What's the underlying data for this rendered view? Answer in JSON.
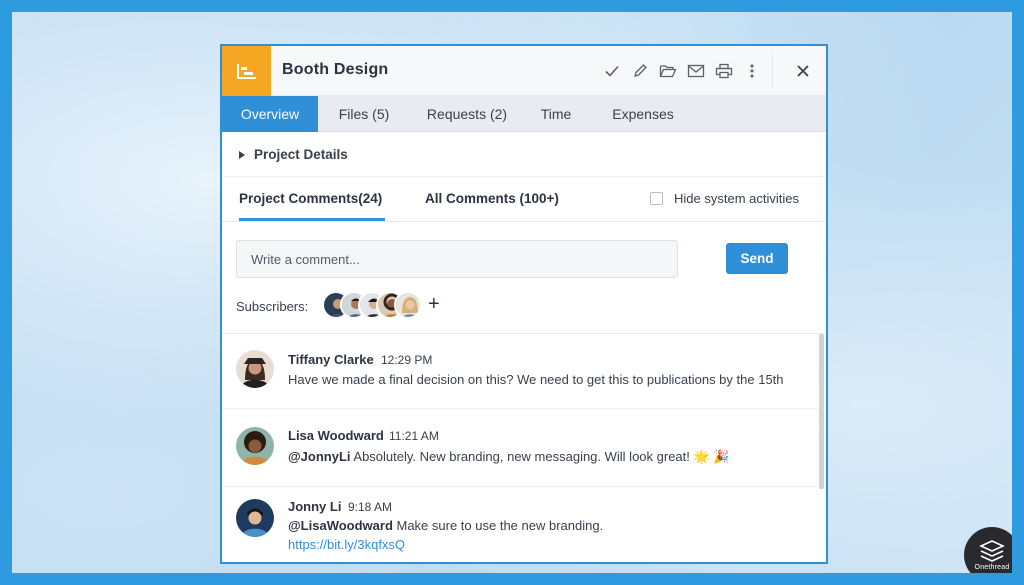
{
  "window": {
    "title": "Booth Design",
    "app_icon": "board-icon",
    "toolbar_icons": [
      "check-icon",
      "pencil-icon",
      "folder-open-icon",
      "mail-icon",
      "print-icon",
      "more-vertical-icon",
      "close-icon"
    ]
  },
  "tabs": [
    {
      "label": "Overview",
      "active": true
    },
    {
      "label": "Files (5)",
      "active": false
    },
    {
      "label": "Requests (2)",
      "active": false
    },
    {
      "label": "Time",
      "active": false
    },
    {
      "label": "Expenses",
      "active": false
    }
  ],
  "project_details": {
    "label": "Project Details"
  },
  "comments": {
    "tabs": [
      {
        "label": "Project Comments(24)",
        "active": true
      },
      {
        "label": "All Comments (100+)",
        "active": false
      }
    ],
    "hide_system_label": "Hide system activities",
    "hide_system_checked": false,
    "input_placeholder": "Write a comment...",
    "send_label": "Send",
    "subscribers_label": "Subscribers:",
    "subscriber_count": 5,
    "add_subscriber_symbol": "+"
  },
  "feed": [
    {
      "name": "Tiffany Clarke",
      "time": "12:29 PM",
      "mention": "",
      "text": "Have we made a final decision on this? We need to get this to publications by the 15th",
      "link": ""
    },
    {
      "name": "Lisa Woodward",
      "time": "11:21 AM",
      "mention": "@JonnyLi",
      "text": " Absolutely. New branding, new messaging. Will look great! 🌟 🎉",
      "link": ""
    },
    {
      "name": "Jonny Li",
      "time": "9:18 AM",
      "mention": "@LisaWoodward",
      "text": " Make sure to use the new branding.",
      "link": "https://bit.ly/3kqfxsQ"
    }
  ],
  "brand": {
    "name": "Onethread"
  },
  "colors": {
    "accent": "#2f8fd8",
    "app_badge": "#f5a623",
    "background": "#2e9ae0"
  }
}
